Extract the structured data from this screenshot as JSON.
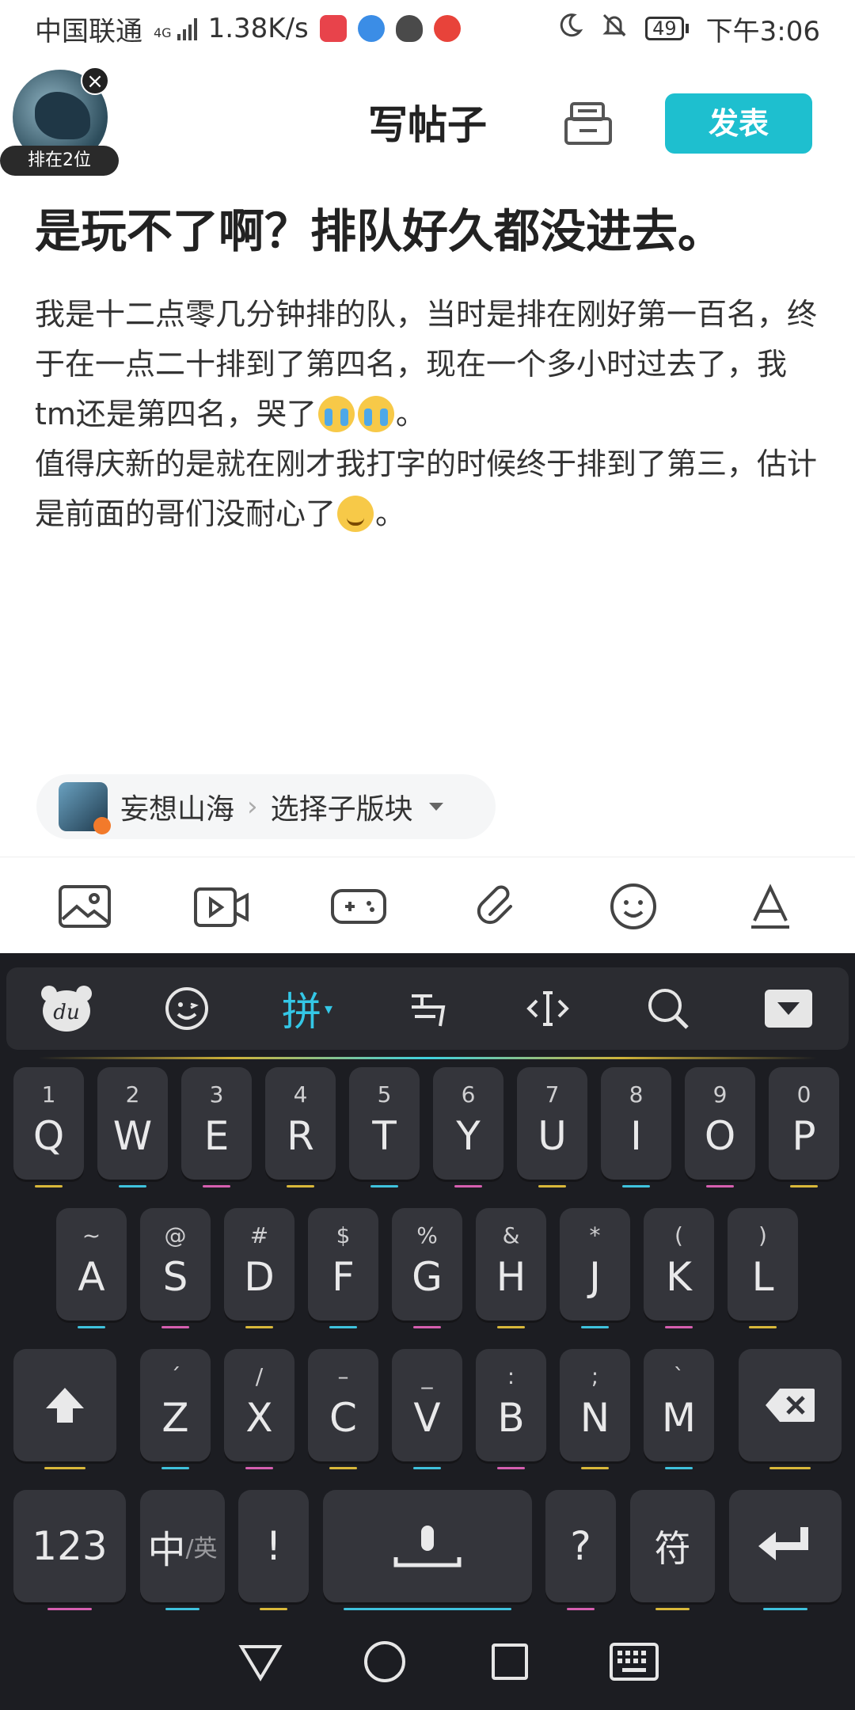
{
  "status_bar": {
    "carrier": "中国联通",
    "network": "4G",
    "speed": "1.38K/s",
    "battery": "49",
    "time": "下午3:06",
    "app_icons": [
      "huawei-store-icon",
      "baidu-icon",
      "qq-icon",
      "weibo-icon"
    ]
  },
  "header": {
    "title": "写帖子",
    "publish_label": "发表",
    "rank_badge": "排在2位"
  },
  "post": {
    "title": "是玩不了啊？排队好久都没进去。",
    "body_line1": "我是十二点零几分钟排的队，当时是排在刚好第一百名，终于在一点二十排到了第四名，现在一个多小时过去了，我tm还是第四名，哭了",
    "body_line1_end": "。",
    "body_line2": "值得庆新的是就在刚才我打字的时候终于排到了第三，估计是前面的哥们没耐心了",
    "body_line2_end": "。"
  },
  "board": {
    "name": "妄想山海",
    "subboard_label": "选择子版块"
  },
  "editor_tools": [
    "image-icon",
    "video-icon",
    "game-icon",
    "link-icon",
    "emoji-icon",
    "text-format-icon"
  ],
  "keyboard": {
    "toolbar": {
      "logo": "du",
      "pinyin": "拼"
    },
    "row1": [
      {
        "num": "1",
        "key": "Q"
      },
      {
        "num": "2",
        "key": "W"
      },
      {
        "num": "3",
        "key": "E"
      },
      {
        "num": "4",
        "key": "R"
      },
      {
        "num": "5",
        "key": "T"
      },
      {
        "num": "6",
        "key": "Y"
      },
      {
        "num": "7",
        "key": "U"
      },
      {
        "num": "8",
        "key": "I"
      },
      {
        "num": "9",
        "key": "O"
      },
      {
        "num": "0",
        "key": "P"
      }
    ],
    "row2": [
      {
        "num": "~",
        "key": "A"
      },
      {
        "num": "@",
        "key": "S"
      },
      {
        "num": "#",
        "key": "D"
      },
      {
        "num": "$",
        "key": "F"
      },
      {
        "num": "%",
        "key": "G"
      },
      {
        "num": "&",
        "key": "H"
      },
      {
        "num": "*",
        "key": "J"
      },
      {
        "num": "(",
        "key": "K"
      },
      {
        "num": ")",
        "key": "L"
      }
    ],
    "row3": [
      {
        "num": "´",
        "key": "Z"
      },
      {
        "num": "/",
        "key": "X"
      },
      {
        "num": "–",
        "key": "C"
      },
      {
        "num": "_",
        "key": "V"
      },
      {
        "num": ":",
        "key": "B"
      },
      {
        "num": ";",
        "key": "N"
      },
      {
        "num": "`",
        "key": "M"
      }
    ],
    "numbers_label": "123",
    "lang_label_main": "中",
    "lang_label_sub": "/英",
    "excl_label": "!",
    "question_label": "?",
    "symbols_label": "符"
  }
}
